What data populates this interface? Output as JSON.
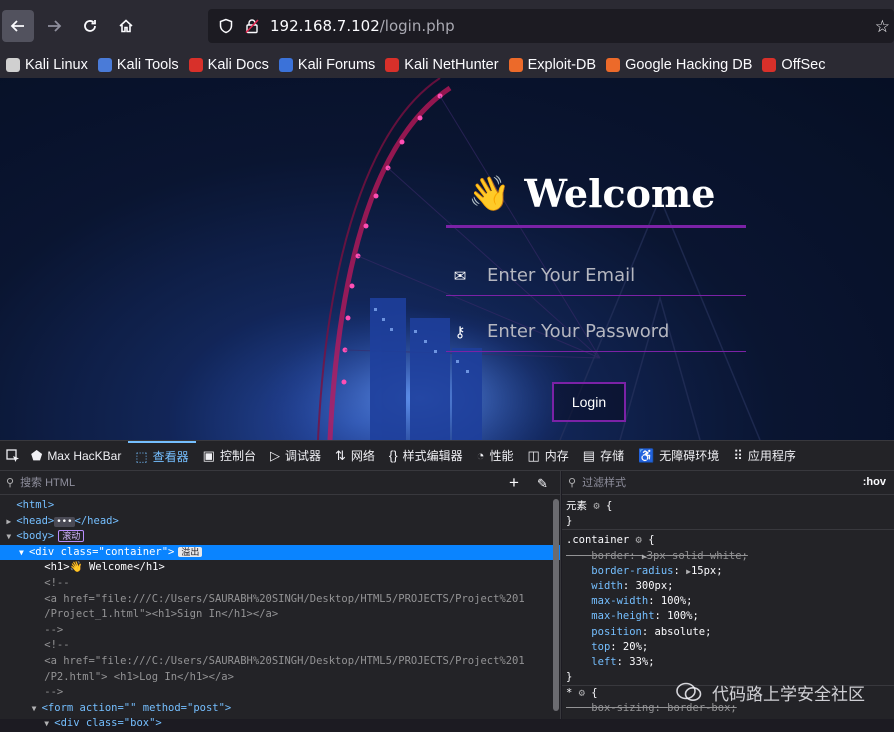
{
  "browser": {
    "url_host": "192.168.7.102",
    "url_path": "/login.php"
  },
  "bookmarks": [
    {
      "label": "Kali Linux",
      "icon": "kali-dragon-icon",
      "color": "#d0d0d0"
    },
    {
      "label": "Kali Tools",
      "icon": "kali-tools-icon",
      "color": "#4a7bd8"
    },
    {
      "label": "Kali Docs",
      "icon": "kali-docs-icon",
      "color": "#d8302a"
    },
    {
      "label": "Kali Forums",
      "icon": "kali-forums-icon",
      "color": "#3b72d9"
    },
    {
      "label": "Kali NetHunter",
      "icon": "nethunter-icon",
      "color": "#d8302a"
    },
    {
      "label": "Exploit-DB",
      "icon": "exploit-db-icon",
      "color": "#ec6a2a"
    },
    {
      "label": "Google Hacking DB",
      "icon": "ghdb-icon",
      "color": "#ec6a2a"
    },
    {
      "label": "OffSec",
      "icon": "offsec-icon",
      "color": "#d8302a"
    }
  ],
  "page": {
    "heading_emoji": "👋",
    "heading": "Welcome",
    "email_placeholder": "Enter Your Email",
    "password_placeholder": "Enter Your Password",
    "login_label": "Login",
    "accent": "#7b22a6"
  },
  "devtools": {
    "tabs": [
      {
        "label": "Max HacKBar",
        "icon": "hackbar-icon"
      },
      {
        "label": "查看器",
        "icon": "inspector-icon",
        "active": true
      },
      {
        "label": "控制台",
        "icon": "console-icon"
      },
      {
        "label": "调试器",
        "icon": "debugger-icon"
      },
      {
        "label": "网络",
        "icon": "network-icon"
      },
      {
        "label": "样式编辑器",
        "icon": "style-editor-icon"
      },
      {
        "label": "性能",
        "icon": "performance-icon"
      },
      {
        "label": "内存",
        "icon": "memory-icon"
      },
      {
        "label": "存储",
        "icon": "storage-icon"
      },
      {
        "label": "无障碍环境",
        "icon": "accessibility-icon"
      },
      {
        "label": "应用程序",
        "icon": "application-icon"
      }
    ],
    "search_placeholder": "搜索 HTML",
    "filter_placeholder": "过滤样式",
    "hov_label": ":hov",
    "badge_scroll": "滚动",
    "badge_overflow": "溢出",
    "tree": {
      "l1": "<html>",
      "l2_open": "<head>",
      "l2_ellipsis": "•••",
      "l2_close": "</head>",
      "l3": "<body>",
      "l4": "<div class=\"container\">",
      "l5": "<h1>👋 Welcome</h1>",
      "l6": "<!--",
      "l7": "<a href=\"file:///C:/Users/SAURABH%20SINGH/Desktop/HTML5/PROJECTS/Project%201",
      "l8": "/Project_1.html\"><h1>Sign In</h1></a>",
      "l9": "-->",
      "l10": "<!--",
      "l11": "<a href=\"file:///C:/Users/SAURABH%20SINGH/Desktop/HTML5/PROJECTS/Project%201",
      "l12": "/P2.html\"> <h1>Log In</h1></a>",
      "l13": "-->",
      "l14": "<form action=\"\" method=\"post\">",
      "l15": "<div class=\"box\">"
    },
    "rules": {
      "element_selector": "元素",
      "container_selector": ".container",
      "decls": [
        {
          "prop": "border",
          "value": "3px solid white",
          "strike": true
        },
        {
          "prop": "border-radius",
          "value": "15px"
        },
        {
          "prop": "width",
          "value": "300px"
        },
        {
          "prop": "max-width",
          "value": "100%"
        },
        {
          "prop": "max-height",
          "value": "100%"
        },
        {
          "prop": "position",
          "value": "absolute"
        },
        {
          "prop": "top",
          "value": "20%"
        },
        {
          "prop": "left",
          "value": "33%"
        }
      ],
      "universal_selector": "*",
      "universal_first": {
        "prop": "box-sizing",
        "value": "border-box"
      }
    }
  },
  "watermark": "代码路上学安全社区"
}
